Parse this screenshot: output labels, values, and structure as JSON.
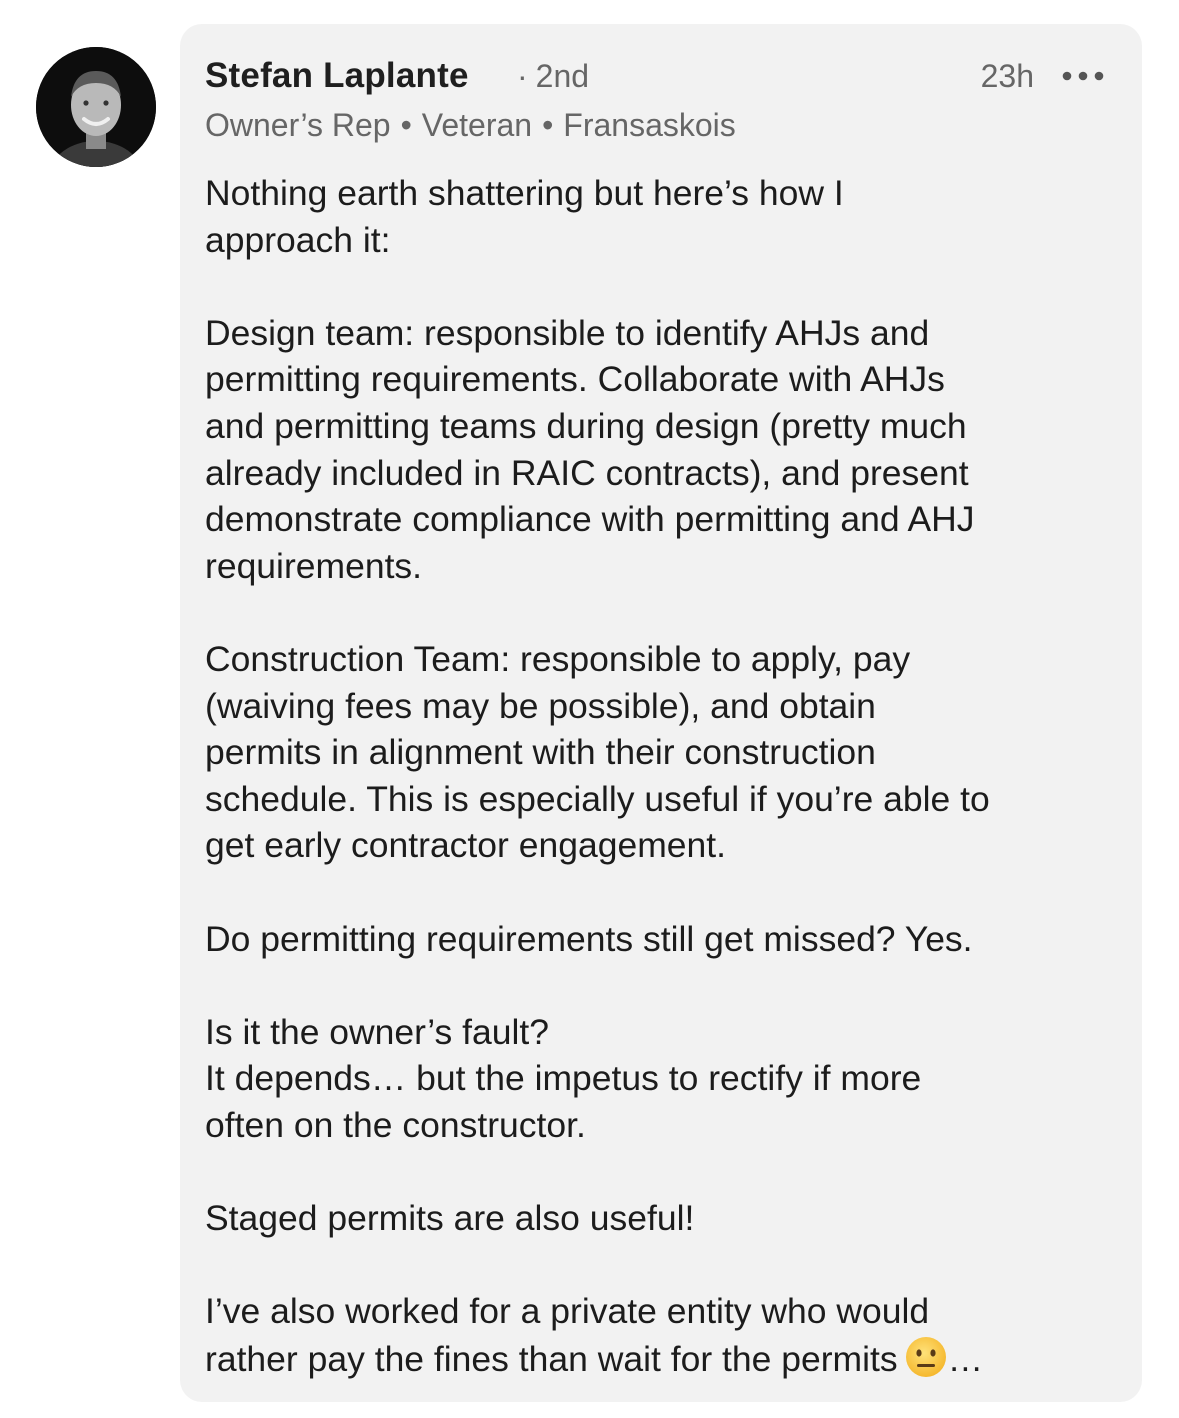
{
  "comment": {
    "author": {
      "name": "Stefan Laplante",
      "degree": "2nd",
      "headline_parts": [
        "Owner’s Rep",
        "Veteran",
        "Fransaskois"
      ],
      "avatar_icon": "profile-photo"
    },
    "timestamp": "23h",
    "more_icon": "ellipsis-icon",
    "paragraphs": [
      [
        "Nothing earth shattering but here’s how I",
        "approach it:"
      ],
      [
        "Design team: responsible to identify AHJs and",
        "permitting requirements. Collaborate with AHJs",
        "and permitting teams during design (pretty much",
        "already included in RAIC contracts), and present",
        "demonstrate compliance with permitting and AHJ",
        "requirements."
      ],
      [
        "Construction Team: responsible to apply, pay",
        "(waiving fees may be possible), and obtain",
        "permits in alignment with their construction",
        "schedule. This is especially useful if you’re able to",
        "get early contractor engagement."
      ],
      [
        "Do permitting requirements still get missed? Yes."
      ],
      [
        "Is it the owner’s fault?",
        "It depends… but the impetus to rectify if more",
        "often on the constructor."
      ],
      [
        "Staged permits are also useful!"
      ],
      [
        "I’ve also worked for a private entity who would",
        "rather pay the fines than wait for the permits"
      ]
    ],
    "trailing_emoji": "neutral-face-emoji",
    "see_more_label": "…"
  }
}
